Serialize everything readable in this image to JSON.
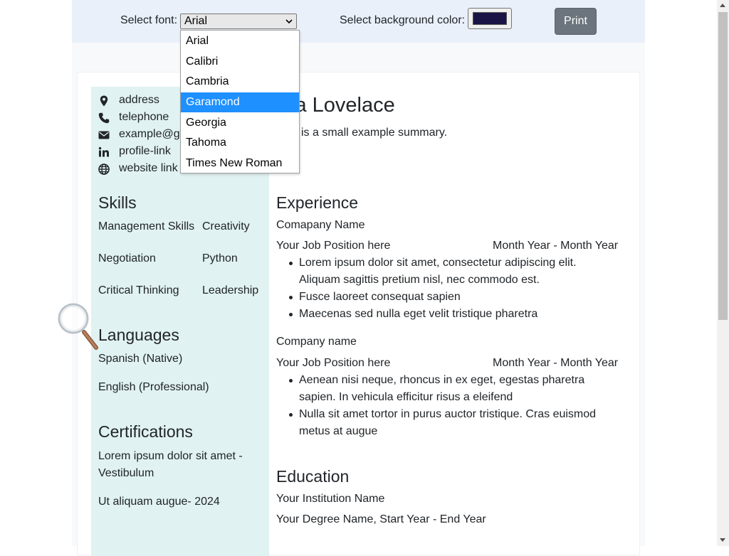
{
  "toolbar": {
    "font_label": "Select font:",
    "font_selected": "Arial",
    "bg_label": "Select background color:",
    "bg_color": "#1a1446",
    "print_label": "Print"
  },
  "font_dropdown": {
    "options": [
      "Arial",
      "Calibri",
      "Cambria",
      "Garamond",
      "Georgia",
      "Tahoma",
      "Times New Roman"
    ],
    "highlighted": "Garamond",
    "highlight_color": "#1e90ff"
  },
  "contact": {
    "address": "address",
    "telephone": "telephone",
    "email": "example@g",
    "profile": "profile-link",
    "website": "website link"
  },
  "header": {
    "name": "la Lovelace",
    "summary": "is a small example summary."
  },
  "skills": {
    "heading": "Skills",
    "left": [
      "Management Skills",
      "Negotiation",
      "Critical Thinking"
    ],
    "right": [
      "Creativity",
      "Python",
      "Leadership"
    ]
  },
  "languages": {
    "heading": "Languages",
    "items": [
      "Spanish (Native)",
      "English (Professional)"
    ]
  },
  "certifications": {
    "heading": "Certifications",
    "items": [
      "Lorem ipsum dolor sit amet -",
      "Vestibulum",
      "Ut aliquam augue- 2024"
    ]
  },
  "experience": {
    "heading": "Experience",
    "jobs": [
      {
        "company": "Comapany Name",
        "position": "Your Job Position here",
        "dates": "Month Year - Month Year",
        "bullets": [
          "Lorem ipsum dolor sit amet, consectetur adipiscing elit.",
          "Aliquam sagittis pretium nisl, nec commodo est.",
          "Fusce laoreet consequat sapien",
          "Maecenas sed nulla eget velit tristique pharetra"
        ]
      },
      {
        "company": "Company name",
        "position": "Your Job Position here",
        "dates": "Month Year - Month Year",
        "bullets": [
          "Aenean nisi neque, rhoncus in ex eget, egestas pharetra",
          "sapien. In vehicula efficitur risus a eleifend",
          "Nulla sit amet tortor in purus auctor tristique. Cras euismod",
          "metus at augue"
        ]
      }
    ]
  },
  "education": {
    "heading": "Education",
    "institution": "Your Institution Name",
    "degree": "Your Degree Name, Start Year - End Year"
  },
  "colors": {
    "sidebar_bg": "#e0f2f1",
    "toolbar_bg": "#eaf0fa",
    "print_btn": "#6c757d"
  }
}
